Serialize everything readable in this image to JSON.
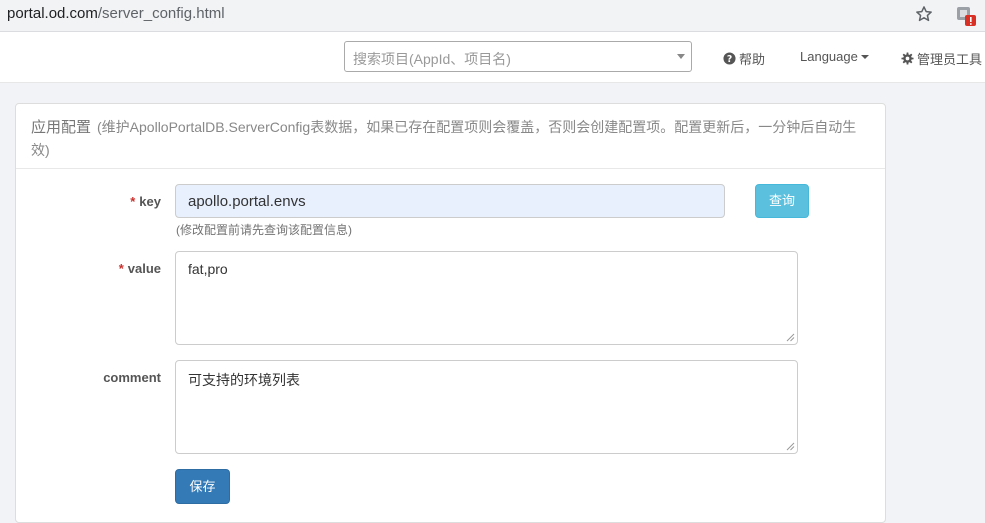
{
  "browser": {
    "url_host": "portal.od.com",
    "url_path": "/server_config.html"
  },
  "navbar": {
    "search_placeholder": "搜索项目(AppId、项目名)",
    "help_label": "帮助",
    "language_label": "Language",
    "admin_label": "管理员工具"
  },
  "panel": {
    "title": "应用配置",
    "description": "(维护ApolloPortalDB.ServerConfig表数据，如果已存在配置项则会覆盖，否则会创建配置项。配置更新后，一分钟后自动生效)"
  },
  "form": {
    "required_mark": "*",
    "key_label": "key",
    "key_value": "apollo.portal.envs",
    "key_help": "(修改配置前请先查询该配置信息)",
    "query_button": "查询",
    "value_label": "value",
    "value_value": "fat,pro",
    "comment_label": "comment",
    "comment_value": "可支持的环境列表",
    "save_button": "保存"
  },
  "icons": {
    "bookmark": "star-icon",
    "extension": "extension-icon",
    "help": "question-circle-icon",
    "admin": "gear-icon"
  },
  "colors": {
    "query_button": "#5bc0de",
    "save_button": "#337ab7",
    "required": "#c9302c",
    "autofill": "#e8f0fe"
  }
}
